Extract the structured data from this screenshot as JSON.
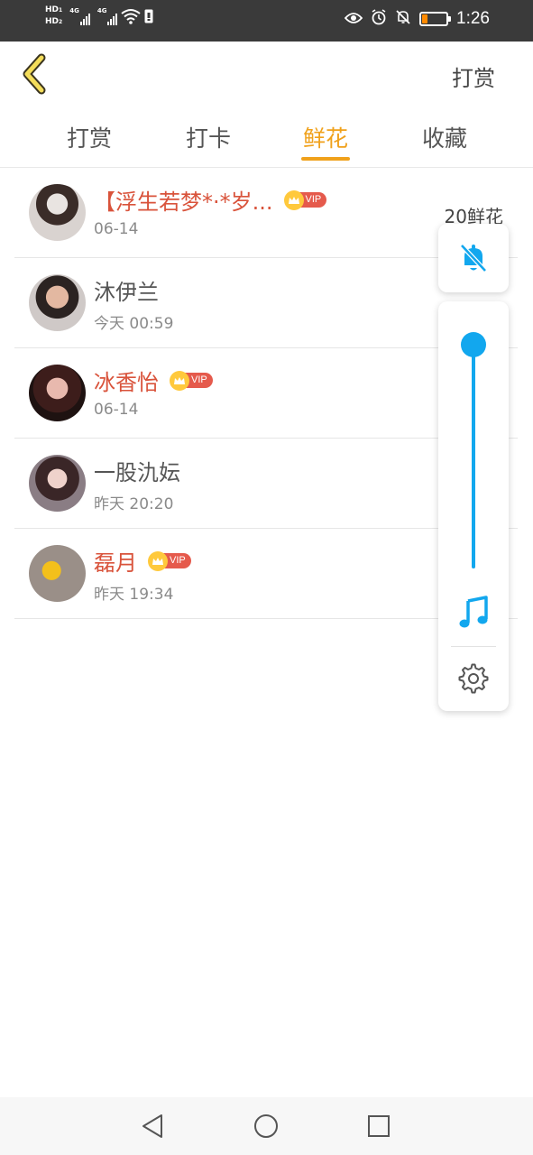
{
  "status_bar": {
    "hd1": "HD",
    "hd1_sub": "1",
    "hd2": "HD",
    "hd2_sub": "2",
    "net1": "4G",
    "net2": "4G",
    "time": "1:26",
    "battery_level": 0.2,
    "battery_color": "#ff8a00"
  },
  "header": {
    "back_icon": "chevron-left-icon",
    "right_label": "打赏"
  },
  "tabs": [
    {
      "label": "打赏",
      "active": false
    },
    {
      "label": "打卡",
      "active": false
    },
    {
      "label": "鲜花",
      "active": true
    },
    {
      "label": "收藏",
      "active": false
    }
  ],
  "list": {
    "vip_label": "VIP",
    "items": [
      {
        "name": "【浮生若梦*·*岁...",
        "time": "06-14",
        "vip": true,
        "amount": "20鲜花"
      },
      {
        "name": "沐伊兰",
        "time": "今天 00:59",
        "vip": false,
        "amount": ""
      },
      {
        "name": "冰香怡",
        "time": "06-14",
        "vip": true,
        "amount": ""
      },
      {
        "name": "一股氿妘",
        "time": "昨天 20:20",
        "vip": false,
        "amount": ""
      },
      {
        "name": "磊月",
        "time": "昨天 19:34",
        "vip": true,
        "amount": ""
      }
    ]
  },
  "volume_panel": {
    "mute_icon": "bell-off-icon",
    "level": 1.0,
    "accent_color": "#12a7ee",
    "music_icon": "music-note-icon",
    "settings_icon": "gear-icon"
  },
  "colors": {
    "accent": "#f0a11b",
    "vip_name": "#d9533b",
    "vip_badge": "#e55a4c",
    "crown": "#ffc93c"
  }
}
